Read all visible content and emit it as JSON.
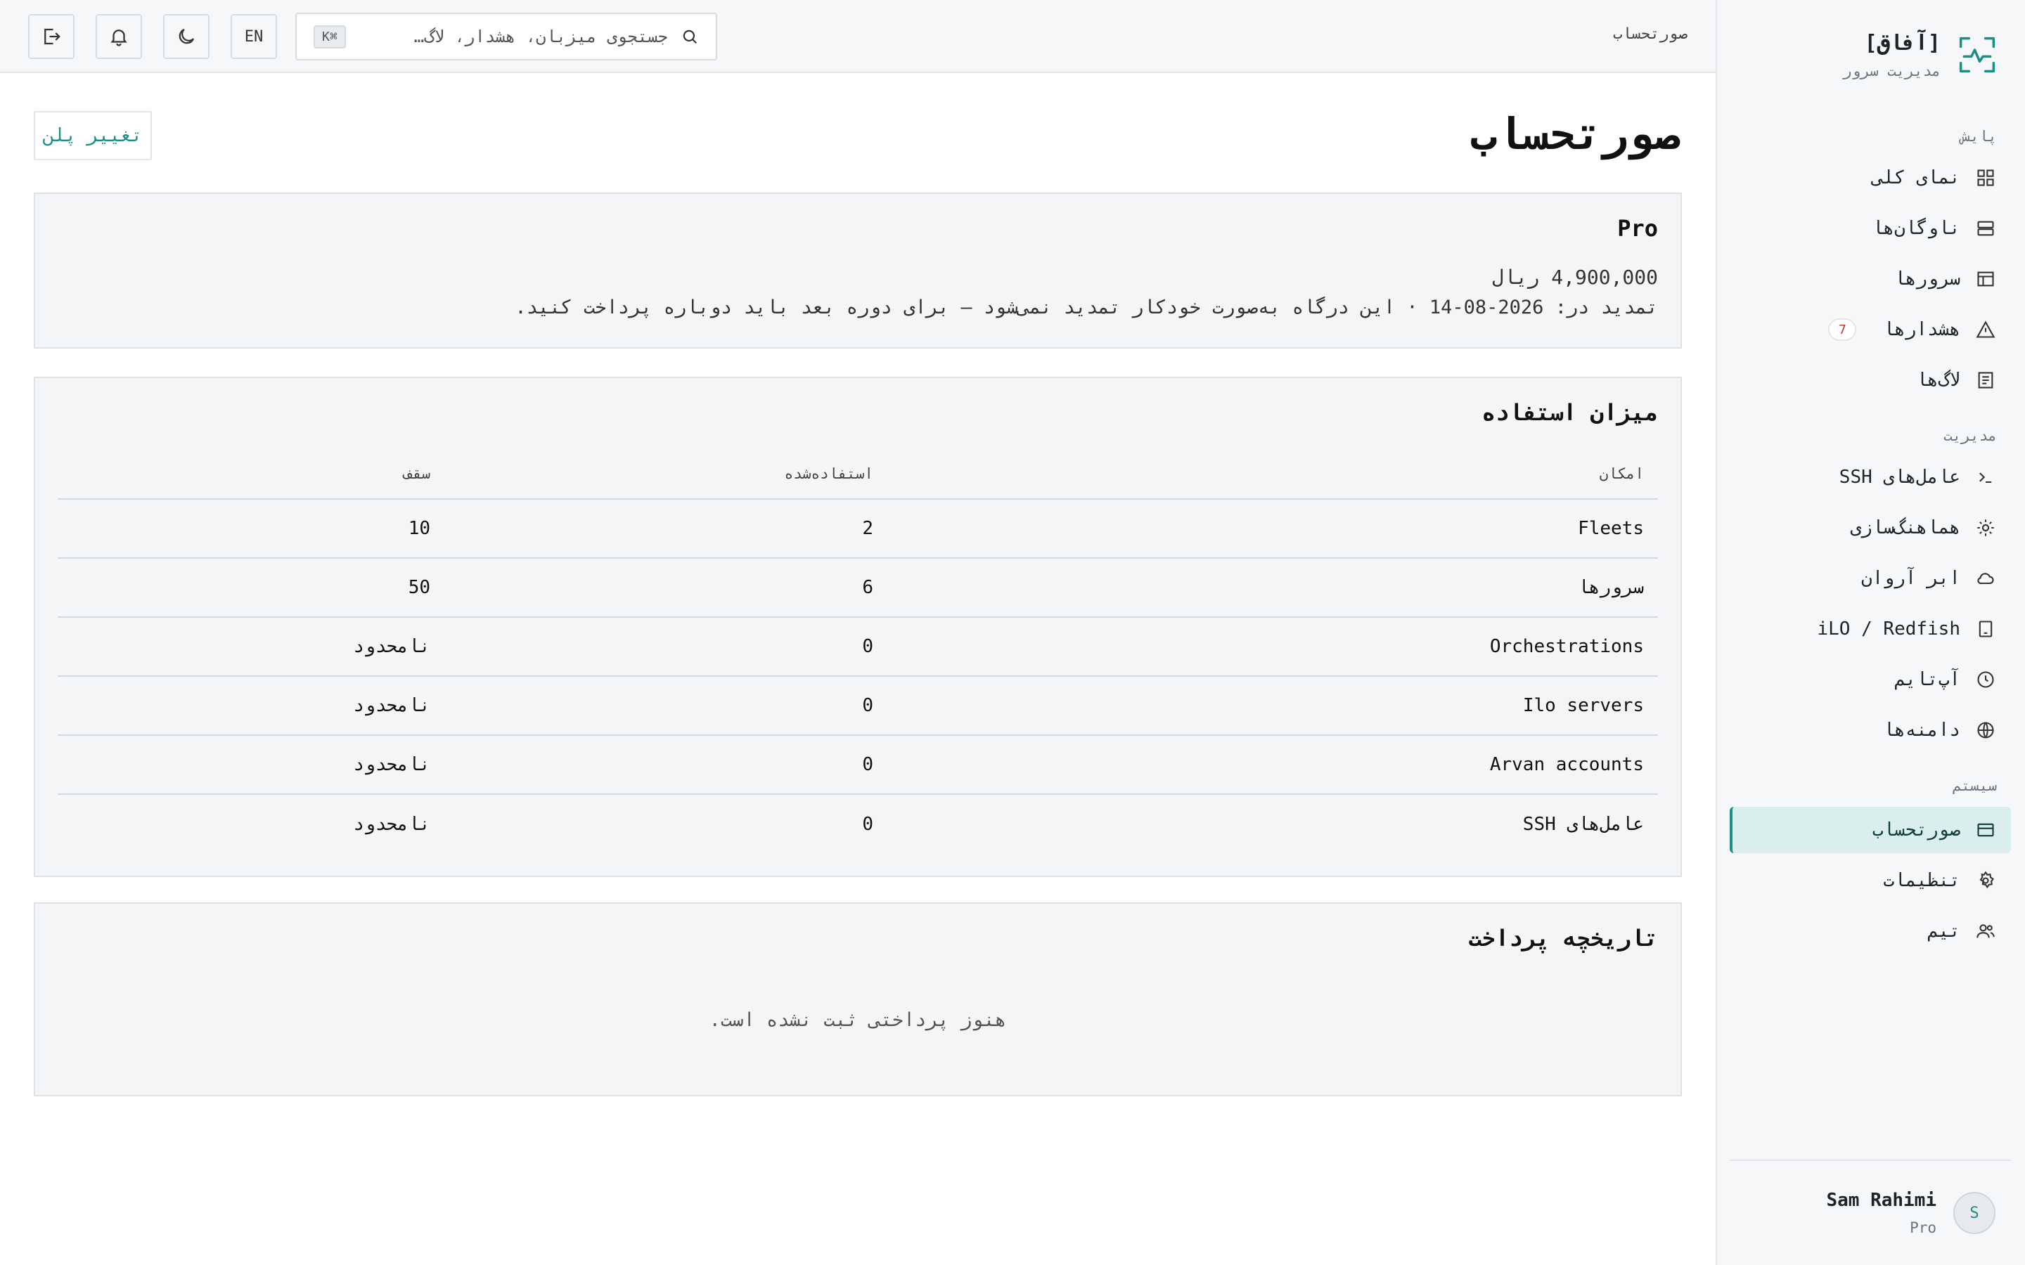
{
  "brand": {
    "title": "[آفاق]",
    "subtitle": "مدیریت سرور",
    "accent": "#1a8f86"
  },
  "sidebar": {
    "sections": {
      "base": "پایش",
      "manage": "مدیریت",
      "system": "سیستم"
    },
    "items": [
      {
        "label": "نمای کلی",
        "icon": "grid-icon"
      },
      {
        "label": "ناوگان‌ها",
        "icon": "server-stack-icon"
      },
      {
        "label": "سرورها",
        "icon": "table-icon"
      },
      {
        "label": "هشدارها",
        "icon": "warning-triangle-icon",
        "badge": "7"
      },
      {
        "label": "لاگ‌ها",
        "icon": "document-lines-icon"
      },
      {
        "label": "عامل‌های SSH",
        "icon": "terminal-prompt-icon"
      },
      {
        "label": "هماهنگ‌سازی",
        "icon": "sun-cog-icon"
      },
      {
        "label": "ابر آروان",
        "icon": "cloud-icon"
      },
      {
        "label": "iLO / Redfish",
        "icon": "tablet-device-icon"
      },
      {
        "label": "آپ‌تایم",
        "icon": "clock-icon"
      },
      {
        "label": "دامنه‌ها",
        "icon": "globe-icon"
      },
      {
        "label": "صورتحساب",
        "icon": "credit-card-icon",
        "active": true
      },
      {
        "label": "تنظیمات",
        "icon": "gear-icon"
      },
      {
        "label": "تیم",
        "icon": "users-icon"
      }
    ],
    "user": {
      "initial": "S",
      "name": "Sam Rahimi",
      "plan": "Pro"
    }
  },
  "topbar": {
    "breadcrumb": "صورتحساب",
    "search_placeholder": "جستجوی میزبان، هشدار، لاگ…",
    "shortcut": "K⌘",
    "lang": "EN"
  },
  "main": {
    "title": "صورتحساب",
    "change_plan_label": "تغییر پلن",
    "plan_card": {
      "plan_name": "Pro",
      "price": "4,900,000 ریال",
      "renewal": "تمدید در: 2026-08-14 · این درگاه به‌صورت خودکار تمدید نمی‌شود — برای دوره بعد باید دوباره پرداخت کنید."
    },
    "usage": {
      "title": "میزان استفاده",
      "headers": {
        "feature": "امکان",
        "used": "استفاده‌شده",
        "limit": "سقف"
      },
      "rows": [
        {
          "feature": "Fleets",
          "used": "2",
          "limit": "10"
        },
        {
          "feature": "سرورها",
          "used": "6",
          "limit": "50"
        },
        {
          "feature": "Orchestrations",
          "used": "0",
          "limit": "نامحدود"
        },
        {
          "feature": "Ilo servers",
          "used": "0",
          "limit": "نامحدود"
        },
        {
          "feature": "Arvan accounts",
          "used": "0",
          "limit": "نامحدود"
        },
        {
          "feature": "عامل‌های SSH",
          "used": "0",
          "limit": "نامحدود"
        }
      ]
    },
    "history": {
      "title": "تاریخچه پرداخت",
      "empty": "هنوز پرداختی ثبت نشده است."
    }
  }
}
